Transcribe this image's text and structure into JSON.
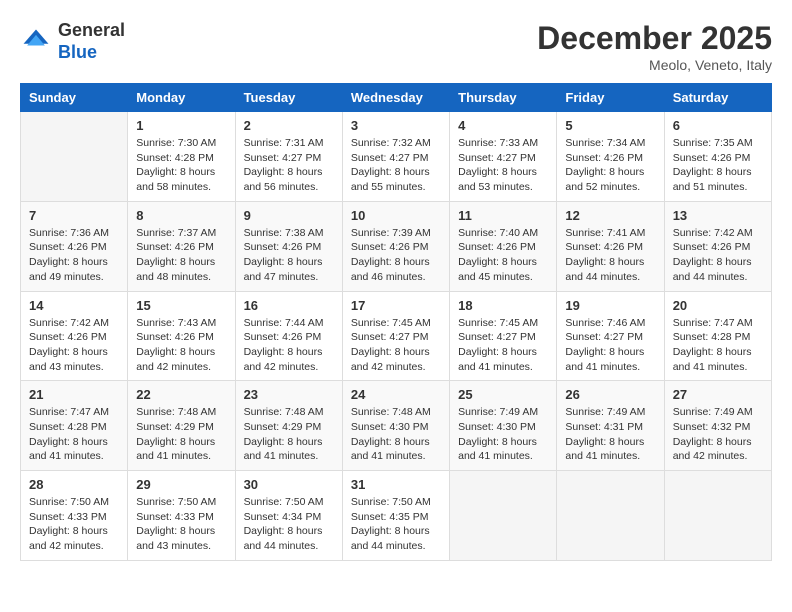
{
  "logo": {
    "general": "General",
    "blue": "Blue"
  },
  "header": {
    "month": "December 2025",
    "location": "Meolo, Veneto, Italy"
  },
  "weekdays": [
    "Sunday",
    "Monday",
    "Tuesday",
    "Wednesday",
    "Thursday",
    "Friday",
    "Saturday"
  ],
  "weeks": [
    [
      {
        "day": "",
        "info": ""
      },
      {
        "day": "1",
        "info": "Sunrise: 7:30 AM\nSunset: 4:28 PM\nDaylight: 8 hours\nand 58 minutes."
      },
      {
        "day": "2",
        "info": "Sunrise: 7:31 AM\nSunset: 4:27 PM\nDaylight: 8 hours\nand 56 minutes."
      },
      {
        "day": "3",
        "info": "Sunrise: 7:32 AM\nSunset: 4:27 PM\nDaylight: 8 hours\nand 55 minutes."
      },
      {
        "day": "4",
        "info": "Sunrise: 7:33 AM\nSunset: 4:27 PM\nDaylight: 8 hours\nand 53 minutes."
      },
      {
        "day": "5",
        "info": "Sunrise: 7:34 AM\nSunset: 4:26 PM\nDaylight: 8 hours\nand 52 minutes."
      },
      {
        "day": "6",
        "info": "Sunrise: 7:35 AM\nSunset: 4:26 PM\nDaylight: 8 hours\nand 51 minutes."
      }
    ],
    [
      {
        "day": "7",
        "info": "Sunrise: 7:36 AM\nSunset: 4:26 PM\nDaylight: 8 hours\nand 49 minutes."
      },
      {
        "day": "8",
        "info": "Sunrise: 7:37 AM\nSunset: 4:26 PM\nDaylight: 8 hours\nand 48 minutes."
      },
      {
        "day": "9",
        "info": "Sunrise: 7:38 AM\nSunset: 4:26 PM\nDaylight: 8 hours\nand 47 minutes."
      },
      {
        "day": "10",
        "info": "Sunrise: 7:39 AM\nSunset: 4:26 PM\nDaylight: 8 hours\nand 46 minutes."
      },
      {
        "day": "11",
        "info": "Sunrise: 7:40 AM\nSunset: 4:26 PM\nDaylight: 8 hours\nand 45 minutes."
      },
      {
        "day": "12",
        "info": "Sunrise: 7:41 AM\nSunset: 4:26 PM\nDaylight: 8 hours\nand 44 minutes."
      },
      {
        "day": "13",
        "info": "Sunrise: 7:42 AM\nSunset: 4:26 PM\nDaylight: 8 hours\nand 44 minutes."
      }
    ],
    [
      {
        "day": "14",
        "info": "Sunrise: 7:42 AM\nSunset: 4:26 PM\nDaylight: 8 hours\nand 43 minutes."
      },
      {
        "day": "15",
        "info": "Sunrise: 7:43 AM\nSunset: 4:26 PM\nDaylight: 8 hours\nand 42 minutes."
      },
      {
        "day": "16",
        "info": "Sunrise: 7:44 AM\nSunset: 4:26 PM\nDaylight: 8 hours\nand 42 minutes."
      },
      {
        "day": "17",
        "info": "Sunrise: 7:45 AM\nSunset: 4:27 PM\nDaylight: 8 hours\nand 42 minutes."
      },
      {
        "day": "18",
        "info": "Sunrise: 7:45 AM\nSunset: 4:27 PM\nDaylight: 8 hours\nand 41 minutes."
      },
      {
        "day": "19",
        "info": "Sunrise: 7:46 AM\nSunset: 4:27 PM\nDaylight: 8 hours\nand 41 minutes."
      },
      {
        "day": "20",
        "info": "Sunrise: 7:47 AM\nSunset: 4:28 PM\nDaylight: 8 hours\nand 41 minutes."
      }
    ],
    [
      {
        "day": "21",
        "info": "Sunrise: 7:47 AM\nSunset: 4:28 PM\nDaylight: 8 hours\nand 41 minutes."
      },
      {
        "day": "22",
        "info": "Sunrise: 7:48 AM\nSunset: 4:29 PM\nDaylight: 8 hours\nand 41 minutes."
      },
      {
        "day": "23",
        "info": "Sunrise: 7:48 AM\nSunset: 4:29 PM\nDaylight: 8 hours\nand 41 minutes."
      },
      {
        "day": "24",
        "info": "Sunrise: 7:48 AM\nSunset: 4:30 PM\nDaylight: 8 hours\nand 41 minutes."
      },
      {
        "day": "25",
        "info": "Sunrise: 7:49 AM\nSunset: 4:30 PM\nDaylight: 8 hours\nand 41 minutes."
      },
      {
        "day": "26",
        "info": "Sunrise: 7:49 AM\nSunset: 4:31 PM\nDaylight: 8 hours\nand 41 minutes."
      },
      {
        "day": "27",
        "info": "Sunrise: 7:49 AM\nSunset: 4:32 PM\nDaylight: 8 hours\nand 42 minutes."
      }
    ],
    [
      {
        "day": "28",
        "info": "Sunrise: 7:50 AM\nSunset: 4:33 PM\nDaylight: 8 hours\nand 42 minutes."
      },
      {
        "day": "29",
        "info": "Sunrise: 7:50 AM\nSunset: 4:33 PM\nDaylight: 8 hours\nand 43 minutes."
      },
      {
        "day": "30",
        "info": "Sunrise: 7:50 AM\nSunset: 4:34 PM\nDaylight: 8 hours\nand 44 minutes."
      },
      {
        "day": "31",
        "info": "Sunrise: 7:50 AM\nSunset: 4:35 PM\nDaylight: 8 hours\nand 44 minutes."
      },
      {
        "day": "",
        "info": ""
      },
      {
        "day": "",
        "info": ""
      },
      {
        "day": "",
        "info": ""
      }
    ]
  ]
}
